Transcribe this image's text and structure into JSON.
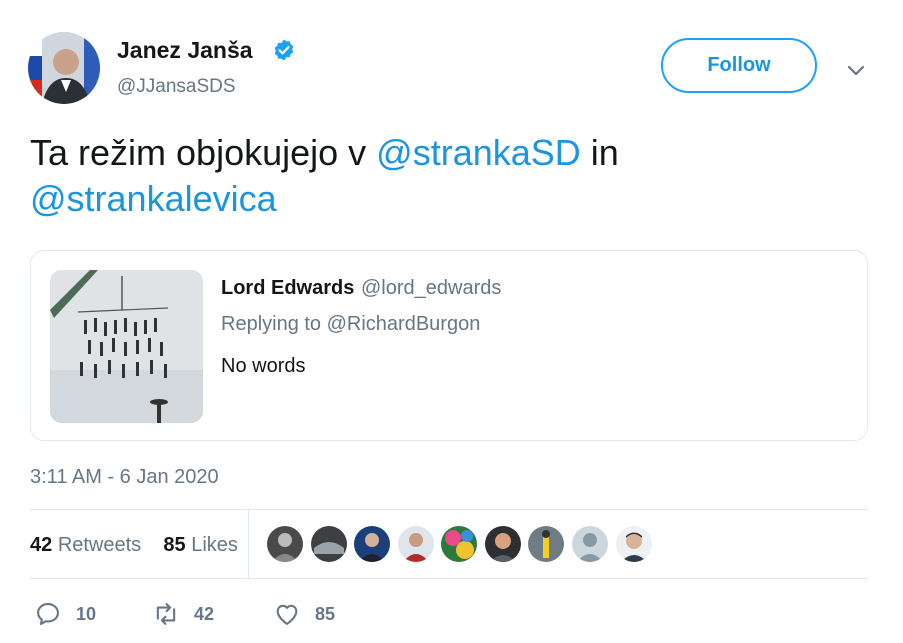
{
  "author": {
    "name": "Janez Janša",
    "handle": "@JJansaSDS",
    "verified": true
  },
  "follow_label": "Follow",
  "tweet": {
    "text_1": "Ta režim objokujejo v ",
    "mention_1": "@strankaSD",
    "text_2": " in ",
    "mention_2": "@strankalevica"
  },
  "quote": {
    "name": "Lord Edwards",
    "handle": "@lord_edwards",
    "replying_to": "Replying to @RichardBurgon",
    "text": "No words"
  },
  "timestamp": "3:11 AM - 6 Jan 2020",
  "stats": {
    "retweets_count": "42",
    "retweets_label": "Retweets",
    "likes_count": "85",
    "likes_label": "Likes"
  },
  "actions": {
    "reply_count": "10",
    "retweet_count": "42",
    "like_count": "85"
  },
  "colors": {
    "accent": "#1da1f2",
    "link": "#1b95e0",
    "secondary_text": "#657786",
    "border": "#e1e8ed"
  }
}
